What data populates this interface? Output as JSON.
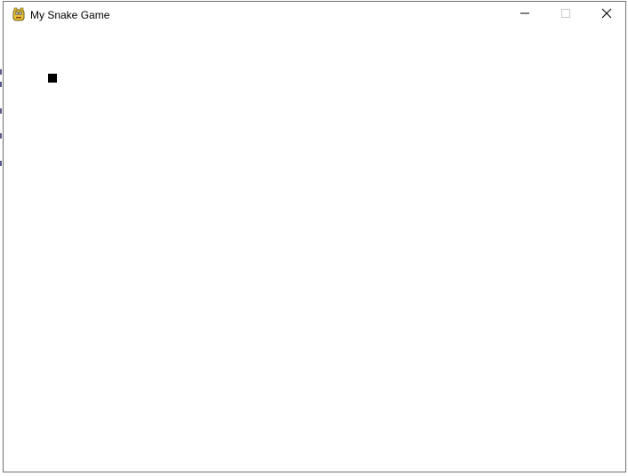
{
  "window": {
    "title": "My Snake Game"
  },
  "icons": {
    "app": "pygame-snake-icon",
    "minimize": "minimize-icon",
    "maximize": "maximize-icon",
    "close": "close-icon"
  },
  "game": {
    "background_color": "#ffffff",
    "snake_color": "#000000"
  }
}
